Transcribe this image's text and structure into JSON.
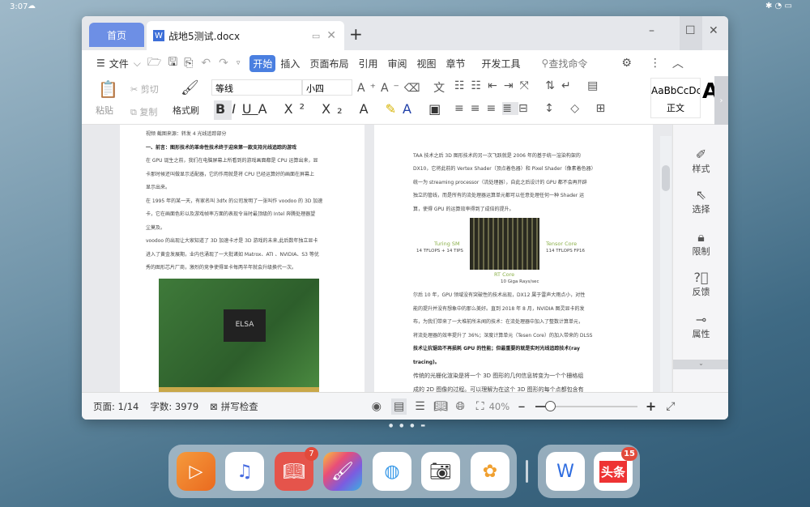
{
  "statusbar": {
    "time": "3:07"
  },
  "tabs": {
    "home": "首页",
    "doc": "战地5测试.docx",
    "add": "+"
  },
  "window": {
    "minimize": "–",
    "maximize": "☐",
    "close": "✕"
  },
  "toolbar1": {
    "file": "文件",
    "menus": [
      "开始",
      "插入",
      "页面布局",
      "引用",
      "审阅",
      "视图",
      "章节",
      "开发工具"
    ],
    "search": "查找命令"
  },
  "toolbar2": {
    "paste": "粘贴",
    "cut": "剪切",
    "copy": "复制",
    "format_painter": "格式刷",
    "font": "等线",
    "size": "小四",
    "style_preview": "AaBbCcDc",
    "style_name": "正文"
  },
  "page_left": {
    "lines": [
      "视频 截图来源：转发 4 光线追踪部分",
      "一、前言：图形技术的革命性技术终于迎来第一款支持光线追踪的游戏",
      "在 GPU 诞生之前，我们在电脑屏幕上所看到的游戏画面都是 CPU 运算出来，显",
      "卡那时候还叫做显示适配器，它的作用就是将 CPU 已经运算好的画面在屏幕上",
      "显示出来。",
      "在 1995 年的某一天，有家名叫 3dfx 的公司发明了一张叫作 voodoo 的 3D 加速",
      "卡，它在画面色彩以及游戏帧率方面的表现令当时最顶级的 Intel 奔腾处理器望",
      "尘莫及。",
      "voodoo 的出现让大家知道了 3D 加速卡才是 3D 游戏的未来,此后数年独立显卡",
      "进入了黄金发展期，业内也涌现了一大批诸如 Matrox、ATI 、NVIDIA、S3 等优",
      "秀的图形芯片厂商，激烈的竞争使得显卡每两半年就会升级换代一次。"
    ]
  },
  "page_right": {
    "lines": [
      "TAA 技术之后 3D 图形技术的另一次飞跃就是 2006 年的基于统一渲染构架的",
      "DX10，它将此前的 Vertex Shader（顶点着色器）和 Pixel Shader（像素着色器）",
      "统一为 streaming processor（流处理器），自此之后设计的 GPU 都不会再开辟",
      "独立的管线，而是所有的流处理器运算单元都可以任意处理任何一种 Shader 运",
      "算，使得 GPU 的运算效率得到了成倍的提升。"
    ],
    "figure": {
      "turing": "Turing SM",
      "turing_perf": "14 TFLOPS + 14 TIPS",
      "tensor": "Tensor Core",
      "tensor_perf": "114 TFLOPS FP16",
      "rt": "RT Core",
      "rt_perf": "10 Giga Rays/sec"
    },
    "lines2": [
      "尔后 10 年，GPU 领域没有突破性的技术出现，DX12 属于雷声大雨点小，对性",
      "能的提升并没有想象中的那么美好。直到 2018 年 8 月，NVIDIA 图灵显卡的发",
      "布，为我们带来了一大堆前所未闻的技术：在流处理器中加入了整数计算单元，",
      "将流处理器的效率提升了 36%；深度计算单元（Tesen Core）的加入带来的 DLSS",
      "技术让抗锯齿不再损耗 GPU 的性能；但最重要的就是实时光线追踪技术(ray",
      "tracing)。",
      "传统的光栅化渲染是将一个 3D 图形的几何信息转变为一个个栅格组",
      "成的 2D 图像的过程。可以理解为在这个 3D 图形的每个点都包含有"
    ]
  },
  "card_label": "ELSA",
  "side_panel": [
    "样式",
    "选择",
    "限制",
    "反馈",
    "属性"
  ],
  "statusbar_doc": {
    "page": "页面: 1/14",
    "words": "字数: 3979",
    "spell": "拼写检查",
    "zoom": "40%"
  },
  "dock": {
    "badges": {
      "books": "7",
      "toutiao": "15"
    },
    "toutiao_label": "头条"
  }
}
